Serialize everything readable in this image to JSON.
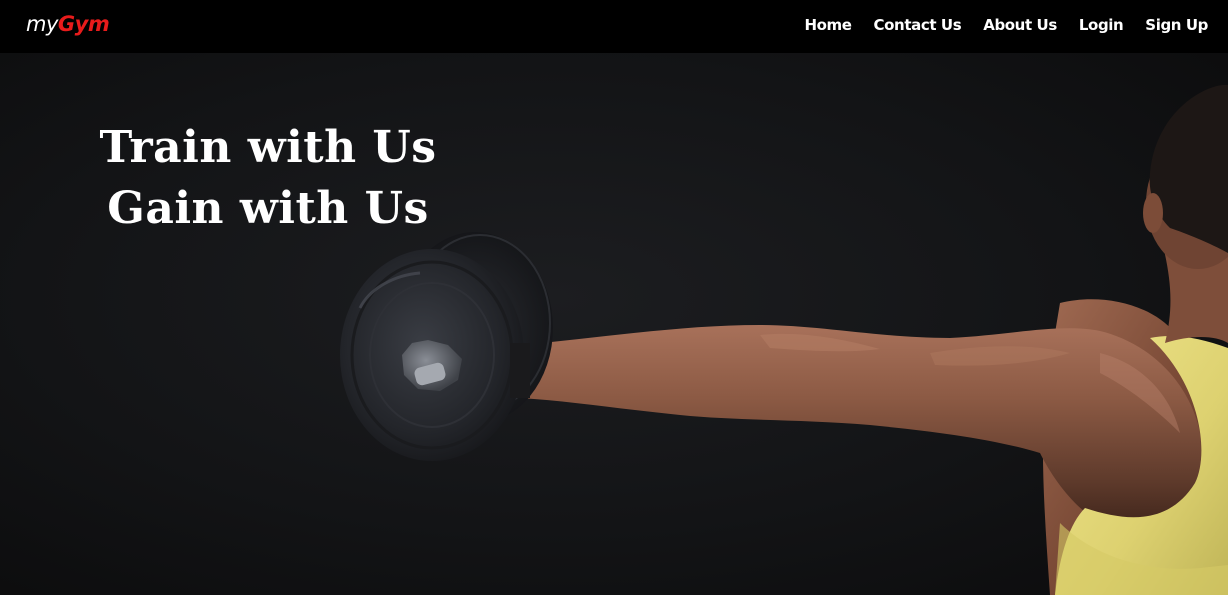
{
  "brand": {
    "prefix": "my",
    "accent": "Gym",
    "accent_color": "#e81b1b"
  },
  "nav": {
    "items": [
      {
        "label": "Home"
      },
      {
        "label": "Contact Us"
      },
      {
        "label": "About Us"
      },
      {
        "label": "Login"
      },
      {
        "label": "Sign Up"
      }
    ]
  },
  "hero": {
    "headline_line1": "Train with Us",
    "headline_line2": "Gain with Us",
    "image_description_icon": "dumbbell-arm-photo"
  },
  "colors": {
    "navbar_bg": "#000000",
    "hero_bg": "#131416",
    "text": "#ffffff",
    "tank_top": "#e6dc78"
  }
}
